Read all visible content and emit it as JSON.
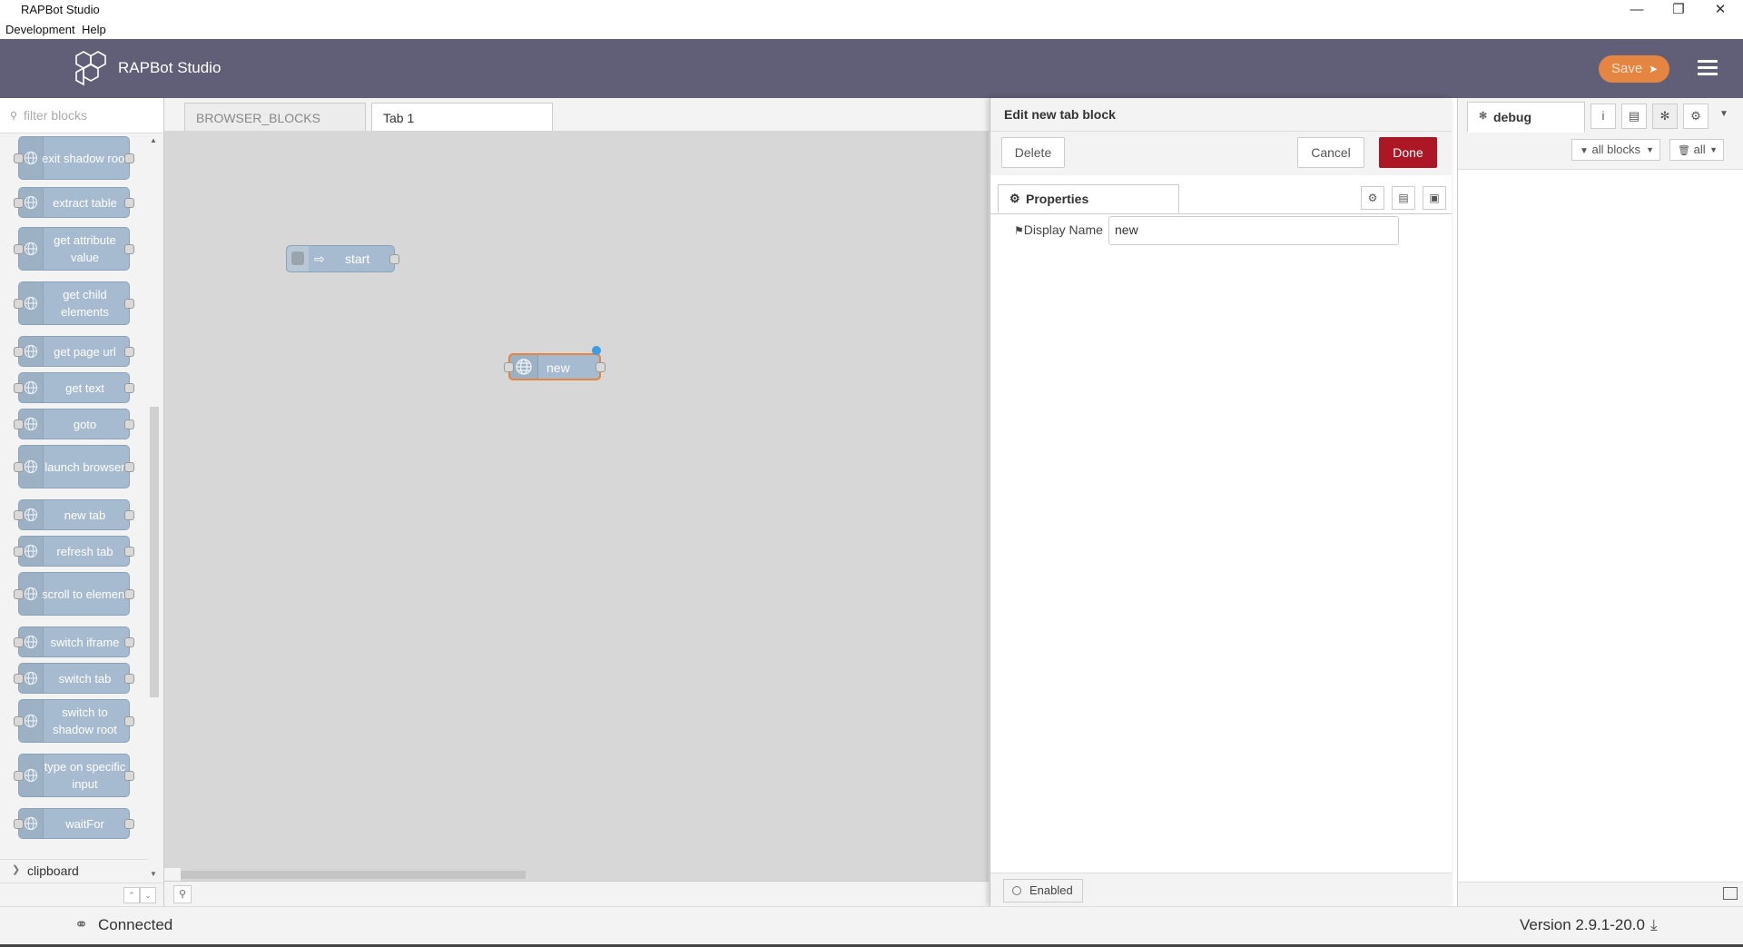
{
  "window": {
    "title": "RAPBot Studio",
    "controls": [
      "minimize",
      "restore",
      "close"
    ]
  },
  "menubar": {
    "items": [
      "Development",
      "Help"
    ]
  },
  "header": {
    "title": "RAPBot Studio",
    "save_label": "Save"
  },
  "palette": {
    "filter_placeholder": "filter blocks",
    "blocks": [
      {
        "label": "exit shadow root"
      },
      {
        "label": "extract table"
      },
      {
        "label": "get attribute value"
      },
      {
        "label": "get child elements"
      },
      {
        "label": "get page url"
      },
      {
        "label": "get text"
      },
      {
        "label": "goto"
      },
      {
        "label": "launch browser"
      },
      {
        "label": "new tab"
      },
      {
        "label": "refresh tab"
      },
      {
        "label": "scroll to element"
      },
      {
        "label": "switch iframe"
      },
      {
        "label": "switch tab"
      },
      {
        "label": "switch to shadow root"
      },
      {
        "label": "type on specific input"
      },
      {
        "label": "waitFor"
      }
    ],
    "category": "clipboard"
  },
  "workspace": {
    "tabs": [
      {
        "label": "BROWSER_BLOCKS",
        "active": false
      },
      {
        "label": "Tab 1",
        "active": true
      }
    ],
    "nodes": [
      {
        "label": "start"
      },
      {
        "label": "new"
      }
    ]
  },
  "editor": {
    "title": "Edit new tab block",
    "delete_label": "Delete",
    "cancel_label": "Cancel",
    "done_label": "Done",
    "tab_label": "Properties",
    "display_name_label": "Display Name",
    "display_name_value": "new",
    "enabled_label": "Enabled"
  },
  "sidebar": {
    "tab_label": "debug",
    "filter_label": "all blocks",
    "clear_label": "all"
  },
  "status": {
    "connection": "Connected",
    "version": "Version 2.9.1-20.0"
  },
  "colors": {
    "header": "#615f77",
    "save_button": "#e58542",
    "done_button": "#ad1625",
    "block": "#a6bbcf",
    "node_selected_border": "#e58542"
  }
}
